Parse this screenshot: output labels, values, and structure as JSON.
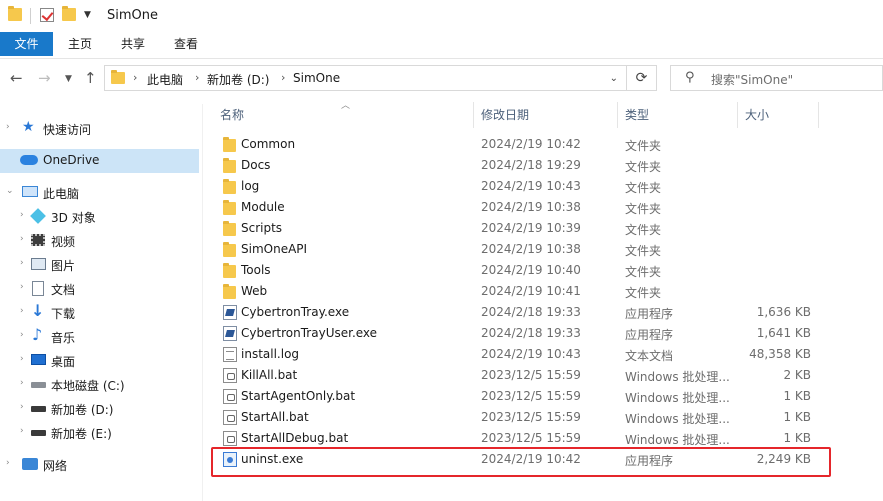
{
  "window": {
    "title": "SimOne"
  },
  "ribbon": {
    "tabs": [
      "文件",
      "主页",
      "共享",
      "查看"
    ]
  },
  "address": {
    "crumbs": [
      "此电脑",
      "新加卷 (D:)",
      "SimOne"
    ]
  },
  "search": {
    "placeholder": "搜索\"SimOne\""
  },
  "sidebar": {
    "items": [
      {
        "label": "快速访问",
        "icon": "star-icon"
      },
      {
        "label": "OneDrive",
        "icon": "cloud-icon"
      },
      {
        "label": "此电脑",
        "icon": "computer-icon"
      },
      {
        "label": "3D 对象",
        "icon": "cube-icon"
      },
      {
        "label": "视频",
        "icon": "video-icon"
      },
      {
        "label": "图片",
        "icon": "picture-icon"
      },
      {
        "label": "文档",
        "icon": "document-icon"
      },
      {
        "label": "下载",
        "icon": "download-icon"
      },
      {
        "label": "音乐",
        "icon": "music-icon"
      },
      {
        "label": "桌面",
        "icon": "desktop-icon"
      },
      {
        "label": "本地磁盘 (C:)",
        "icon": "drive-icon"
      },
      {
        "label": "新加卷 (D:)",
        "icon": "drive-icon"
      },
      {
        "label": "新加卷 (E:)",
        "icon": "drive-icon"
      },
      {
        "label": "网络",
        "icon": "network-icon"
      }
    ]
  },
  "columns": {
    "name": "名称",
    "date": "修改日期",
    "type": "类型",
    "size": "大小"
  },
  "files": [
    {
      "name": "Common",
      "date": "2024/2/19 10:42",
      "type": "文件夹",
      "size": "",
      "icon": "folder-icon"
    },
    {
      "name": "Docs",
      "date": "2024/2/18 19:29",
      "type": "文件夹",
      "size": "",
      "icon": "folder-icon"
    },
    {
      "name": "log",
      "date": "2024/2/19 10:43",
      "type": "文件夹",
      "size": "",
      "icon": "folder-icon"
    },
    {
      "name": "Module",
      "date": "2024/2/19 10:38",
      "type": "文件夹",
      "size": "",
      "icon": "folder-icon"
    },
    {
      "name": "Scripts",
      "date": "2024/2/19 10:39",
      "type": "文件夹",
      "size": "",
      "icon": "folder-icon"
    },
    {
      "name": "SimOneAPI",
      "date": "2024/2/19 10:38",
      "type": "文件夹",
      "size": "",
      "icon": "folder-icon"
    },
    {
      "name": "Tools",
      "date": "2024/2/19 10:40",
      "type": "文件夹",
      "size": "",
      "icon": "folder-icon"
    },
    {
      "name": "Web",
      "date": "2024/2/19 10:41",
      "type": "文件夹",
      "size": "",
      "icon": "folder-icon"
    },
    {
      "name": "CybertronTray.exe",
      "date": "2024/2/18 19:33",
      "type": "应用程序",
      "size": "1,636 KB",
      "icon": "exe-icon"
    },
    {
      "name": "CybertronTrayUser.exe",
      "date": "2024/2/18 19:33",
      "type": "应用程序",
      "size": "1,641 KB",
      "icon": "exe-icon"
    },
    {
      "name": "install.log",
      "date": "2024/2/19 10:43",
      "type": "文本文档",
      "size": "48,358 KB",
      "icon": "text-file-icon"
    },
    {
      "name": "KillAll.bat",
      "date": "2023/12/5 15:59",
      "type": "Windows 批处理...",
      "size": "2 KB",
      "icon": "batch-file-icon"
    },
    {
      "name": "StartAgentOnly.bat",
      "date": "2023/12/5 15:59",
      "type": "Windows 批处理...",
      "size": "1 KB",
      "icon": "batch-file-icon"
    },
    {
      "name": "StartAll.bat",
      "date": "2023/12/5 15:59",
      "type": "Windows 批处理...",
      "size": "1 KB",
      "icon": "batch-file-icon"
    },
    {
      "name": "StartAllDebug.bat",
      "date": "2023/12/5 15:59",
      "type": "Windows 批处理...",
      "size": "1 KB",
      "icon": "batch-file-icon"
    },
    {
      "name": "uninst.exe",
      "date": "2024/2/19 10:42",
      "type": "应用程序",
      "size": "2,249 KB",
      "icon": "uninstaller-icon"
    }
  ],
  "colors": {
    "accent": "#1979ca",
    "selection": "#cce4f7",
    "highlight": "#e5262b",
    "folder": "#f6c84c"
  }
}
